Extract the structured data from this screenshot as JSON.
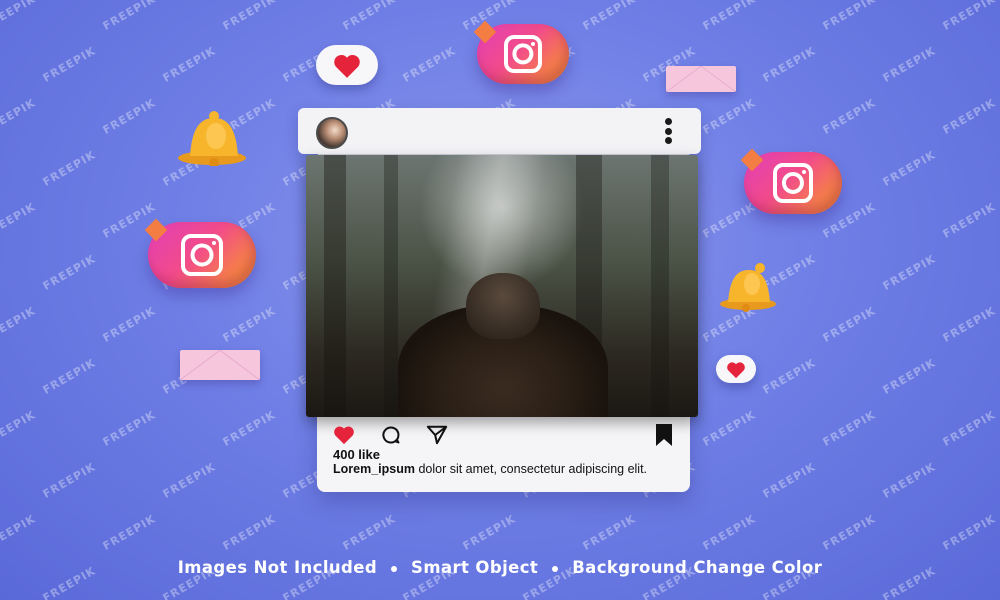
{
  "watermark": {
    "text": "FREEPIK"
  },
  "post": {
    "likes": "400 like",
    "caption_user": "Lorem_ipsum",
    "caption_text": " dolor sit amet, consectetur adipiscing elit."
  },
  "footer": {
    "items": [
      "Images Not Included",
      "Smart Object",
      "Background Change Color"
    ]
  },
  "colors": {
    "background": "#6f7fe6",
    "heart": "#e5243b",
    "instagram_gradient": [
      "#e23fb8",
      "#f24b8a",
      "#f7893d",
      "#fbb130"
    ],
    "envelope": "#f6c6dd",
    "bell": "#f7b52b"
  },
  "icons": {
    "post_avatar": "avatar",
    "post_more": "more-vertical-icon",
    "like": "heart-icon",
    "comment": "comment-icon",
    "share": "send-icon",
    "save": "bookmark-icon",
    "decorations": [
      "instagram-icon",
      "heart-icon",
      "bell-icon",
      "envelope-icon"
    ]
  }
}
